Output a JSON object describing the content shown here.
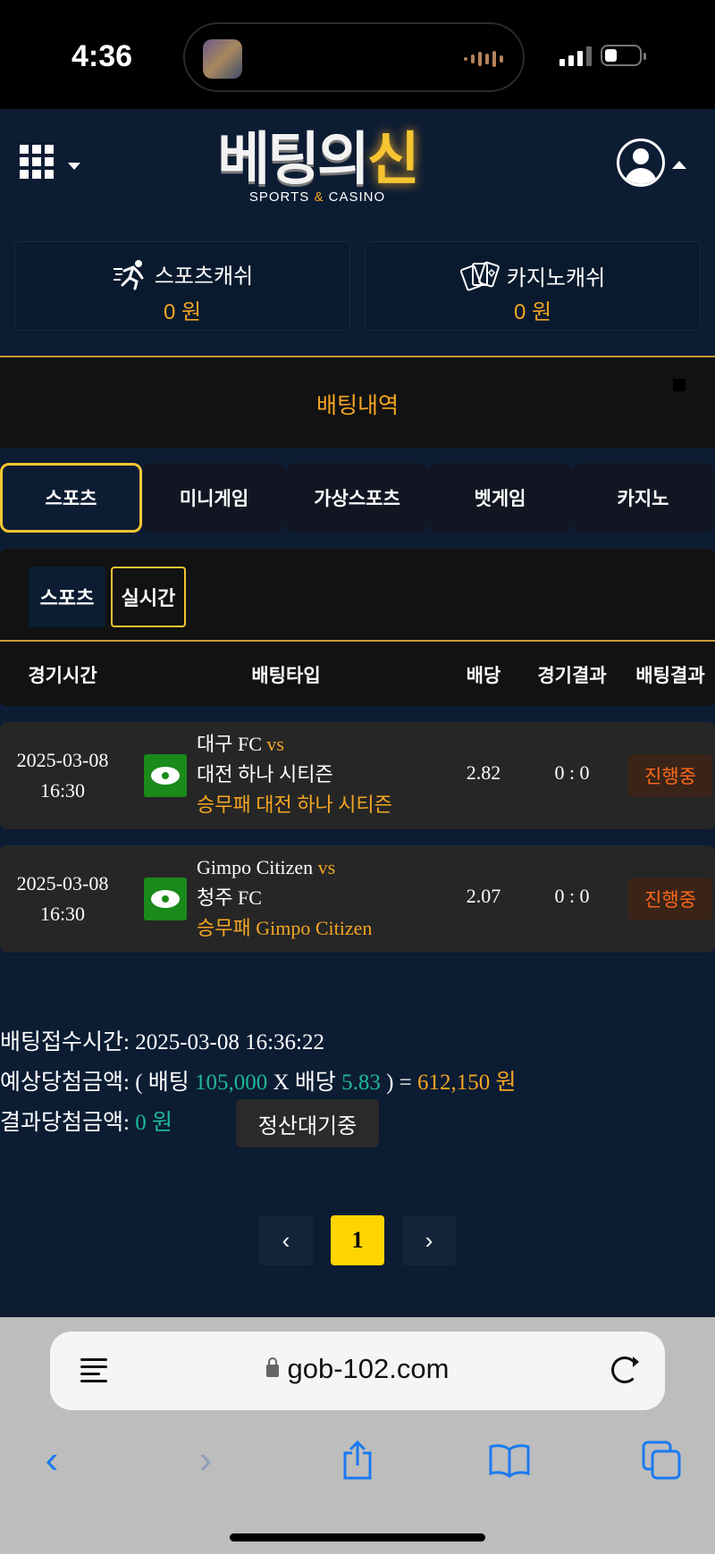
{
  "status_bar": {
    "time": "4:36"
  },
  "header": {
    "logo_main": "베팅의",
    "logo_accent": "신",
    "logo_sub_a": "SPORTS",
    "logo_sub_amp": "&",
    "logo_sub_b": "CASINO"
  },
  "cash": [
    {
      "label": "스포츠캐쉬",
      "amount": "0 원",
      "icon": "running-icon"
    },
    {
      "label": "카지노캐쉬",
      "amount": "0 원",
      "icon": "cards-icon"
    }
  ],
  "page_title": "배팅내역",
  "tabs": [
    "스포츠",
    "미니게임",
    "가상스포츠",
    "벳게임",
    "카지노"
  ],
  "active_tab": "스포츠",
  "sub_tabs": [
    "스포츠",
    "실시간"
  ],
  "active_sub_tab": "실시간",
  "table": {
    "headers": [
      "경기시간",
      "배팅타입",
      "배당",
      "경기결과",
      "배팅결과"
    ],
    "rows": [
      {
        "date": "2025-03-08",
        "time": "16:30",
        "home": "대구 FC",
        "vs": "vs",
        "away": "대전 하나 시티즌",
        "pick": "승무패 대전 하나 시티즌",
        "odds": "2.82",
        "score": "0 : 0",
        "status": "진행중"
      },
      {
        "date": "2025-03-08",
        "time": "16:30",
        "home": "Gimpo Citizen",
        "vs": "vs",
        "away": "청주 FC",
        "pick": "승무패 Gimpo Citizen",
        "odds": "2.07",
        "score": "0 : 0",
        "status": "진행중"
      }
    ]
  },
  "summary": {
    "received_label": "배팅접수시간:",
    "received_value": "2025-03-08 16:36:22",
    "expected_label": "예상당첨금액:",
    "expected_open": "( 배팅",
    "bet_amount": "105,000",
    "x_label": "X 배당",
    "total_odds": "5.83",
    "expected_close": ") =",
    "expected_win": "612,150 원",
    "result_label": "결과당첨금액:",
    "result_value": "0 원",
    "pending_label": "정산대기중"
  },
  "pagination": {
    "prev": "‹",
    "current": "1",
    "next": "›"
  },
  "browser": {
    "url": "gob-102.com"
  }
}
